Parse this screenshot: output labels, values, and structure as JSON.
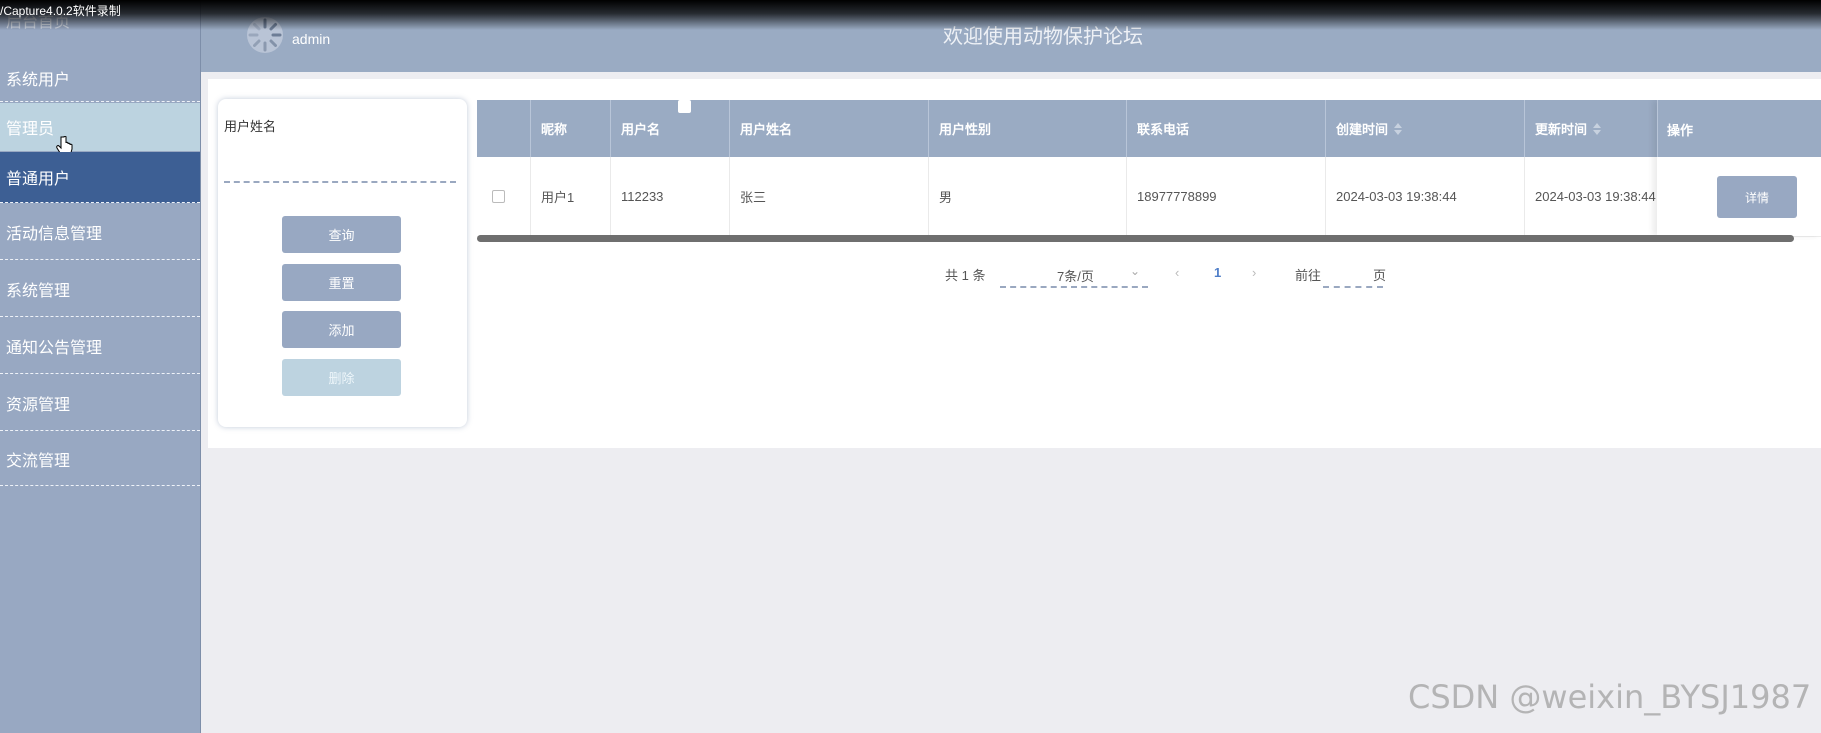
{
  "recording": {
    "text": "/Capture4.0.2软件录制"
  },
  "sidebar": {
    "home": "后台首页",
    "items": [
      {
        "label": "系统用户"
      },
      {
        "label": "管理员"
      },
      {
        "label": "普通用户"
      },
      {
        "label": "活动信息管理"
      },
      {
        "label": "系统管理"
      },
      {
        "label": "通知公告管理"
      },
      {
        "label": "资源管理"
      },
      {
        "label": "交流管理"
      }
    ]
  },
  "header": {
    "username": "admin",
    "title": "欢迎使用动物保护论坛"
  },
  "search": {
    "label": "用户姓名",
    "value": "",
    "buttons": {
      "query": "查询",
      "reset": "重置",
      "add": "添加",
      "delete": "删除"
    }
  },
  "table": {
    "columns": [
      "昵称",
      "用户名",
      "用户姓名",
      "用户性别",
      "联系电话",
      "创建时间",
      "更新时间",
      "操作"
    ],
    "rows": [
      {
        "nickname": "用户1",
        "username": "112233",
        "realname": "张三",
        "gender": "男",
        "phone": "18977778899",
        "created": "2024-03-03 19:38:44",
        "updated": "2024-03-03 19:38:44",
        "action": "详情"
      }
    ]
  },
  "pagination": {
    "total": "共 1 条",
    "page_size": "7条/页",
    "current_page": "1",
    "goto_prefix": "前往",
    "goto_suffix": "页"
  },
  "watermark": "CSDN @weixin_BYSJ1987"
}
